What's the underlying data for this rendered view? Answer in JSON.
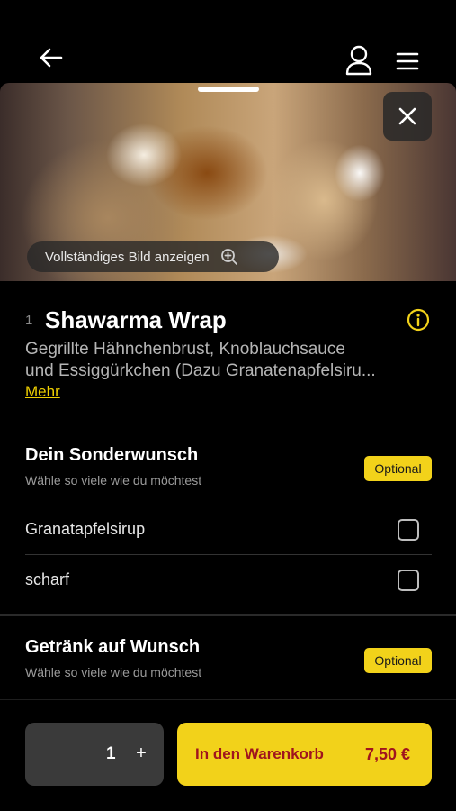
{
  "header": {
    "back_icon": "arrow-left-icon",
    "account_icon": "user-icon",
    "menu_icon": "hamburger-menu-icon"
  },
  "hero": {
    "close_icon": "close-icon",
    "show_full_image_label": "Vollständiges Bild anzeigen",
    "zoom_icon": "zoom-in-icon"
  },
  "product": {
    "number": "1",
    "title": "Shawarma Wrap",
    "description_line1": "Gegrillte Hähnchenbrust, Knoblauchsauce",
    "description_line2": "und Essiggürkchen (Dazu Granatenapfelsiru...",
    "more_label": "Mehr",
    "info_icon": "info-icon"
  },
  "sections": [
    {
      "title": "Dein Sonderwunsch",
      "subtitle": "Wähle so viele wie du möchtest",
      "badge": "Optional",
      "options": [
        {
          "label": "Granatapfelsirup",
          "checked": false
        },
        {
          "label": "scharf",
          "checked": false
        }
      ]
    },
    {
      "title": "Getränk auf Wunsch",
      "subtitle": "Wähle so viele wie du möchtest",
      "badge": "Optional",
      "options": []
    }
  ],
  "footer": {
    "quantity": "1",
    "plus_label": "+",
    "add_to_cart_label": "In den Warenkorb",
    "price": "7,50 €"
  },
  "colors": {
    "accent": "#f2d21a",
    "cart_text": "#a0141e",
    "background": "#000000"
  }
}
